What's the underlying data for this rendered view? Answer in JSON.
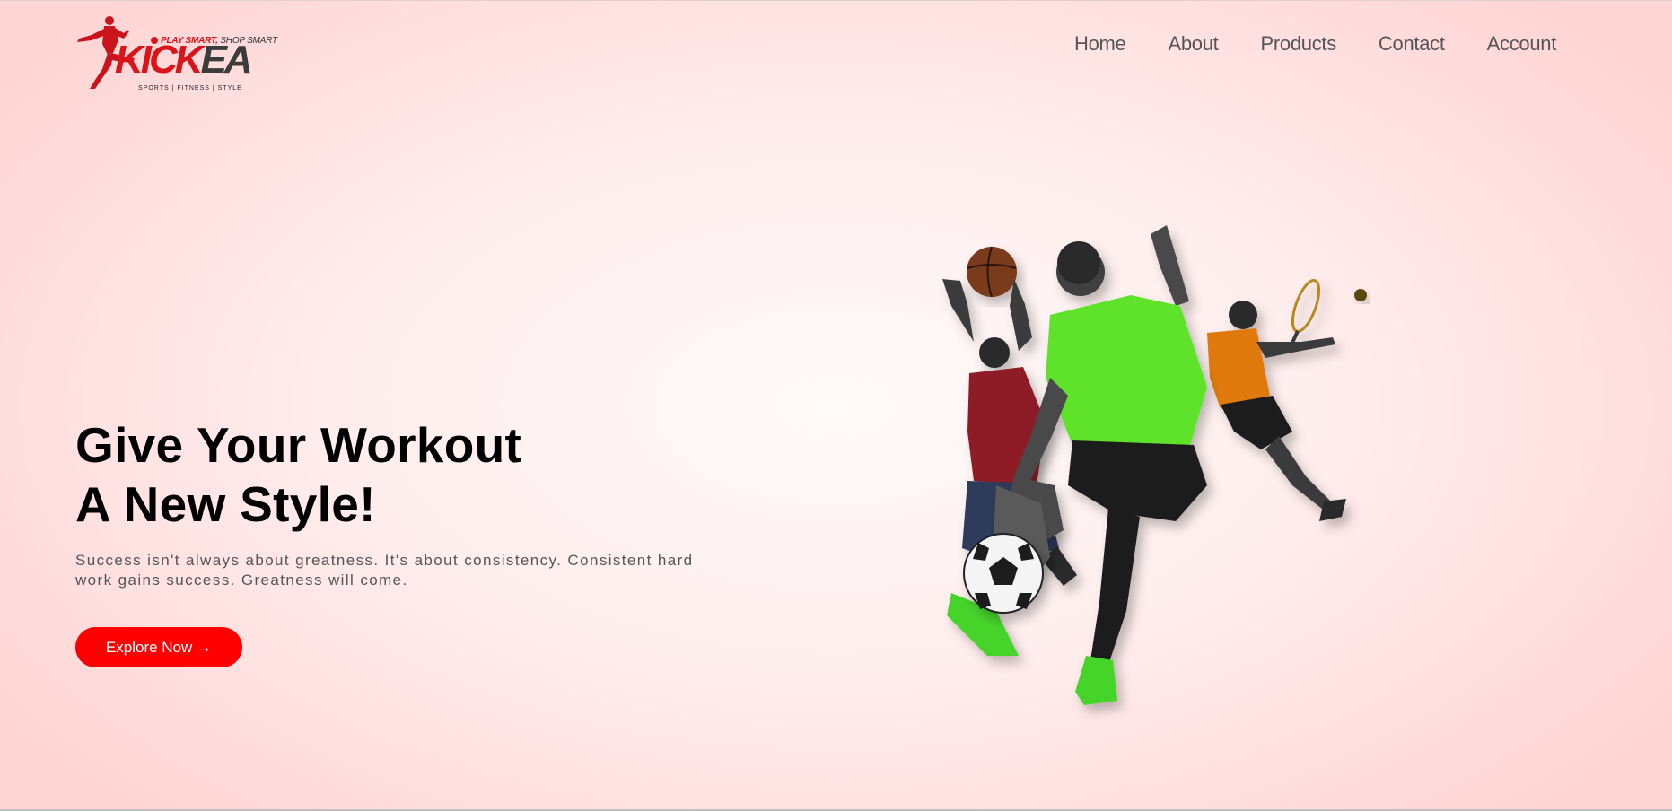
{
  "brand": {
    "tagline_play": "PLAY SMART,",
    "tagline_shop": "SHOP SMART",
    "name_part1": "KICK",
    "name_part2": "EA",
    "subline": "SPORTS  |  FITNESS  |  STYLE",
    "colors": {
      "red": "#d9141a",
      "dark": "#3c3c3c"
    }
  },
  "nav": {
    "items": [
      {
        "label": "Home"
      },
      {
        "label": "About"
      },
      {
        "label": "Products"
      },
      {
        "label": "Contact"
      },
      {
        "label": "Account"
      }
    ]
  },
  "hero": {
    "headline_line1": "Give Your Workout",
    "headline_line2": "A New Style!",
    "description": "Success isn't always about greatness. It's about consistency. Consistent hard work gains success. Greatness will come.",
    "cta_label": "Explore Now →",
    "cta_color": "#ff0000",
    "image": {
      "icon": "athletes-collage-image",
      "subjects": [
        "basketball-player",
        "soccer-player",
        "tennis-player",
        "soccer-ball",
        "basketball",
        "tennis-ball"
      ]
    }
  }
}
